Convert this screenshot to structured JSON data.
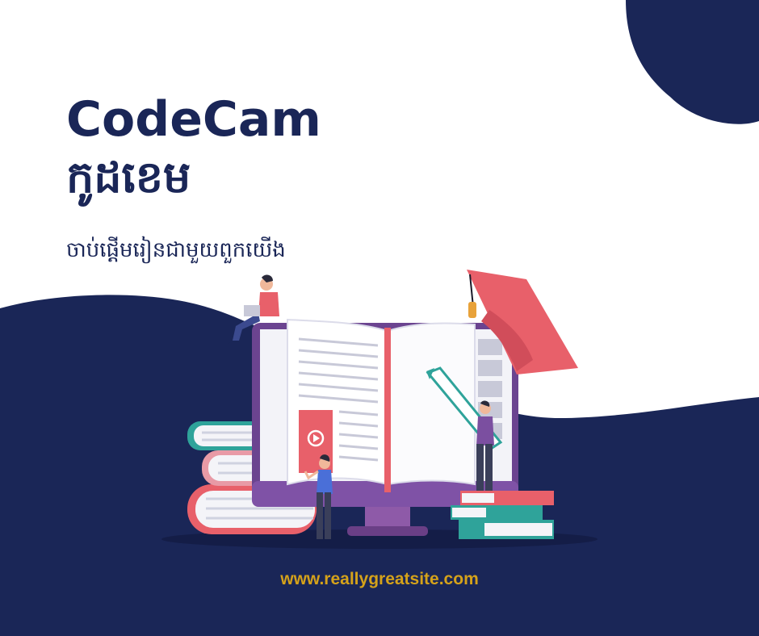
{
  "brand": {
    "title_en": "CodeCam",
    "title_km": "កូដខេម",
    "subtitle": "ចាប់ផ្តើមរៀនជាមួយពួកយើង"
  },
  "footer": {
    "website": "www.reallygreatsite.com"
  },
  "colors": {
    "navy": "#1a2657",
    "accent_gold": "#d5a21a",
    "coral": "#e8606a",
    "teal": "#2fa39a",
    "purple": "#7b4fa0"
  },
  "illustration": {
    "icons": [
      "laptop-person-icon",
      "graduation-cap-icon",
      "open-book-icon",
      "monitor-icon",
      "book-stack-icon",
      "pencil-icon",
      "play-icon"
    ]
  }
}
